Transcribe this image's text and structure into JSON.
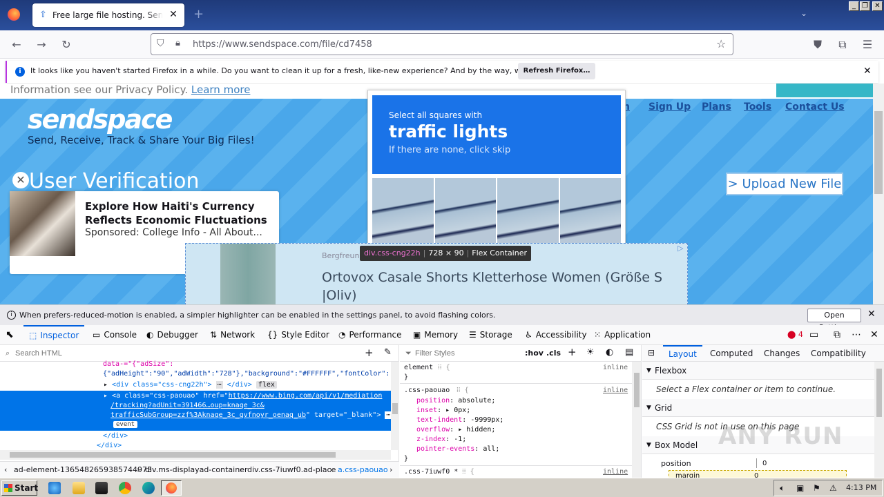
{
  "browser": {
    "tab_title": "Free large file hosting. Send big files",
    "tab_close": "✕",
    "new_tab": "+",
    "list_tabs": "⌄",
    "window_buttons": [
      "_",
      "❐",
      "✕"
    ],
    "url": "https://www.sendspace.com/file/cd7458",
    "notification": {
      "text": "It looks like you haven't started Firefox in a while. Do you want to clean it up for a fresh, like-new experience? And by the way, welcome back!",
      "button": "Refresh Firefox…",
      "icon": "info-icon"
    }
  },
  "page": {
    "privacy_text": "Information see our Privacy Policy.",
    "privacy_link": "Learn more",
    "logo": "sendspace",
    "tagline": "Send, Receive, Track & Share Your Big Files!",
    "nav_links": [
      "n",
      "Sign Up",
      "Plans",
      "Tools",
      "Contact Us"
    ],
    "title": "User Verification",
    "upload_button": "> Upload New File",
    "ad": {
      "headline": "Explore How Haiti's Currency Reflects Economic Fluctuations",
      "sponsor": "Sponsored: College Info - All About..."
    },
    "captcha": {
      "line1": "Select all squares with",
      "line2": "traffic lights",
      "line3": "If there are none, click skip"
    },
    "ad2": {
      "brand": "Bergfreunde",
      "title": "Ortovox Casale Shorts Kletterhose Women (Größe S |Oliv)",
      "adchoice": "▷"
    },
    "highlighter": {
      "tag": "div.css-cng22h",
      "size": "728 × 90",
      "type": "Flex Container"
    }
  },
  "devtools": {
    "reduced_motion_text": "When prefers-reduced-motion is enabled, a simpler highlighter can be enabled in the settings panel, to avoid flashing colors.",
    "open_settings": "Open Settings",
    "tabs": [
      {
        "label": "Inspector",
        "icon": "⬚"
      },
      {
        "label": "Console",
        "icon": "▭"
      },
      {
        "label": "Debugger",
        "icon": "◐"
      },
      {
        "label": "Network",
        "icon": "⇅"
      },
      {
        "label": "Style Editor",
        "icon": "{}"
      },
      {
        "label": "Performance",
        "icon": "◔"
      },
      {
        "label": "Memory",
        "icon": "▣"
      },
      {
        "label": "Storage",
        "icon": "☰"
      },
      {
        "label": "Accessibility",
        "icon": "♿"
      },
      {
        "label": "Application",
        "icon": "⁙"
      }
    ],
    "error_count": "4",
    "search_html_placeholder": "Search HTML",
    "markup": {
      "line1": "data-=\"{\"adSize\":",
      "line2": "{\"adHeight\":\"90\",\"adWidth\":\"728\"},\"background\":\"#FFFFFF\",\"fontColor\":",
      "line3_tag": "<div class=\"css-cng22h\">",
      "line3_end": "</div>",
      "line3_badge": "flex",
      "sel_open": "<a class=\"css-paouao\" href=\"",
      "sel_href1": "https://www.bing.com/api/v1/mediation",
      "sel_href2": "/tracking?adUnit=391466…oup=knaqe_3c&",
      "sel_href3": "trafficSubGroup=zzf%3Aknaqe_3c_qvfnoyr_oenaq_ub",
      "sel_target": "\" target=\"_blank\">",
      "sel_badge": "event",
      "close_div": "</div>",
      "close_div2": "</div>"
    },
    "breadcrumbs": [
      "ad-element-1365482659385744973",
      "div.ms-displayad-container",
      "div.css-7iuwf0.ad-place",
      "a.css-paouao"
    ],
    "filter_styles_placeholder": "Filter Styles",
    "hov": ":hov",
    "cls": ".cls",
    "rules": {
      "element_selector": "element",
      "inline": "inline",
      "selector2": ".css-paouao",
      "decls": [
        {
          "prop": "position",
          "val": "absolute;"
        },
        {
          "prop": "inset",
          "val": "▸ 0px;"
        },
        {
          "prop": "text-indent",
          "val": "-9999px;"
        },
        {
          "prop": "overflow",
          "val": "▸ hidden;"
        },
        {
          "prop": "z-index",
          "val": "-1;"
        },
        {
          "prop": "pointer-events",
          "val": "all;"
        }
      ],
      "selector3": ".css-7iuwf0 *"
    },
    "layout_tabs": [
      "Layout",
      "Computed",
      "Changes",
      "Compatibility"
    ],
    "sections": {
      "flexbox": "Flexbox",
      "flexbox_note": "Select a Flex container or item to continue.",
      "grid": "Grid",
      "grid_note": "CSS Grid is not in use on this page",
      "boxmodel": "Box Model",
      "position_label": "position",
      "position_val": "0",
      "margin_label": "margin",
      "margin_val": "0"
    }
  },
  "watermark": "ANY RUN",
  "taskbar": {
    "start": "Start",
    "clock": "4:13 PM"
  }
}
